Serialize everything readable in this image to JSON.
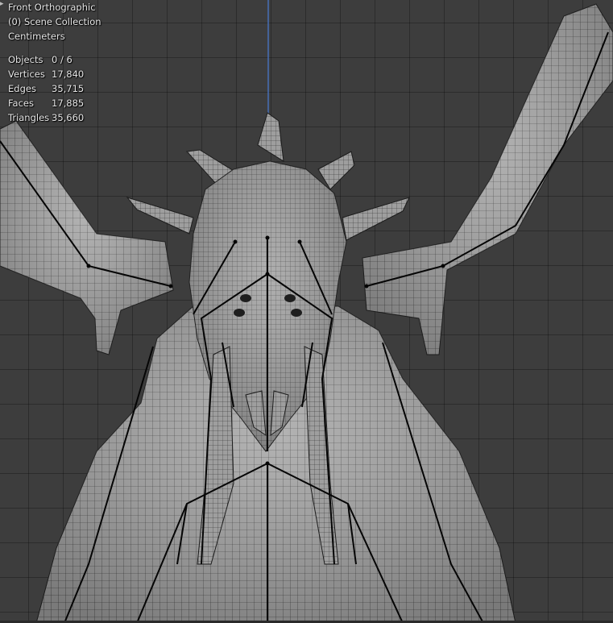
{
  "viewport": {
    "view_name": "Front Orthographic",
    "collection": "(0) Scene Collection",
    "units": "Centimeters"
  },
  "stats": [
    {
      "label": "Objects",
      "value": "0 / 6"
    },
    {
      "label": "Vertices",
      "value": "17,840"
    },
    {
      "label": "Edges",
      "value": "35,715"
    },
    {
      "label": "Faces",
      "value": "17,885"
    },
    {
      "label": "Triangles",
      "value": "35,660"
    }
  ],
  "colors": {
    "background": "#3d3d3d",
    "mesh_fill": "#9c9c9c",
    "wireframe": "#2a2a2a",
    "armature": "#000000",
    "axis_z": "#4a7bd4"
  },
  "icons": {
    "collapse": "chevron-right-icon"
  }
}
